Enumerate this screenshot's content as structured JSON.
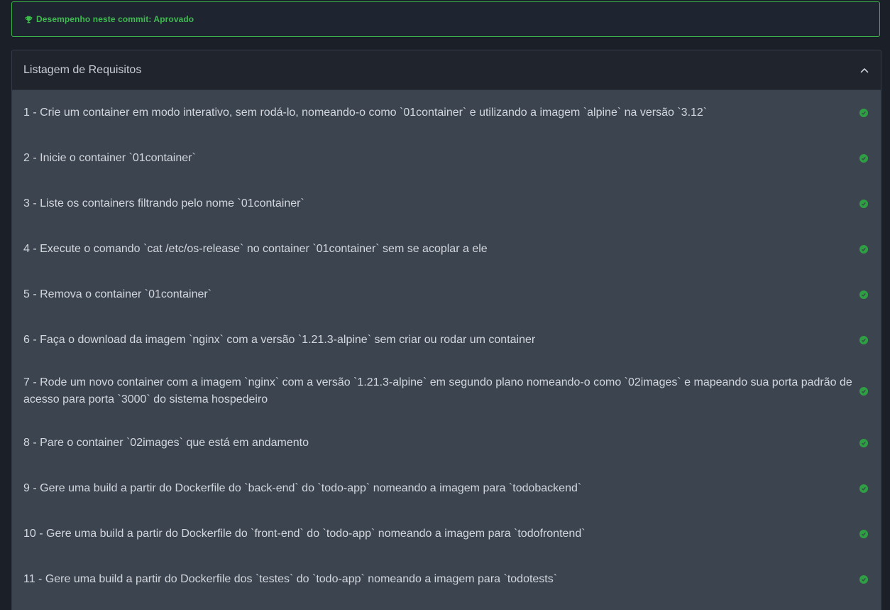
{
  "banner": {
    "text": "Desempenho neste commit: Aprovado",
    "icon": "trophy-icon",
    "color": "#3fb950"
  },
  "panel": {
    "title": "Listagem de Requisitos",
    "toggle_icon": "chevron-up-icon"
  },
  "requirements": [
    {
      "label": "1 - Crie um container em modo interativo, sem rodá-lo, nomeando-o como `01container` e utilizando a imagem `alpine` na versão `3.12`",
      "status": "passed"
    },
    {
      "label": "2 - Inicie o container `01container`",
      "status": "passed"
    },
    {
      "label": "3 - Liste os containers filtrando pelo nome `01container`",
      "status": "passed"
    },
    {
      "label": "4 - Execute o comando `cat /etc/os-release` no container `01container` sem se acoplar a ele",
      "status": "passed"
    },
    {
      "label": "5 - Remova o container `01container`",
      "status": "passed"
    },
    {
      "label": "6 - Faça o download da imagem `nginx` com a versão `1.21.3-alpine` sem criar ou rodar um container",
      "status": "passed"
    },
    {
      "label": "7 - Rode um novo container com a imagem `nginx` com a versão `1.21.3-alpine` em segundo plano nomeando-o como `02images` e mapeando sua porta padrão de acesso para porta `3000` do sistema hospedeiro",
      "status": "passed"
    },
    {
      "label": "8 - Pare o container `02images` que está em andamento",
      "status": "passed"
    },
    {
      "label": "9 - Gere uma build a partir do Dockerfile do `back-end` do `todo-app` nomeando a imagem para `todobackend`",
      "status": "passed"
    },
    {
      "label": "10 - Gere uma build a partir do Dockerfile do `front-end` do `todo-app` nomeando a imagem para `todofrontend`",
      "status": "passed"
    },
    {
      "label": "11 - Gere uma build a partir do Dockerfile dos `testes` do `todo-app` nomeando a imagem para `todotests`",
      "status": "passed"
    }
  ],
  "colors": {
    "success": "#2ea043",
    "background": "#1b1f28",
    "row_background": "#3c4450"
  }
}
